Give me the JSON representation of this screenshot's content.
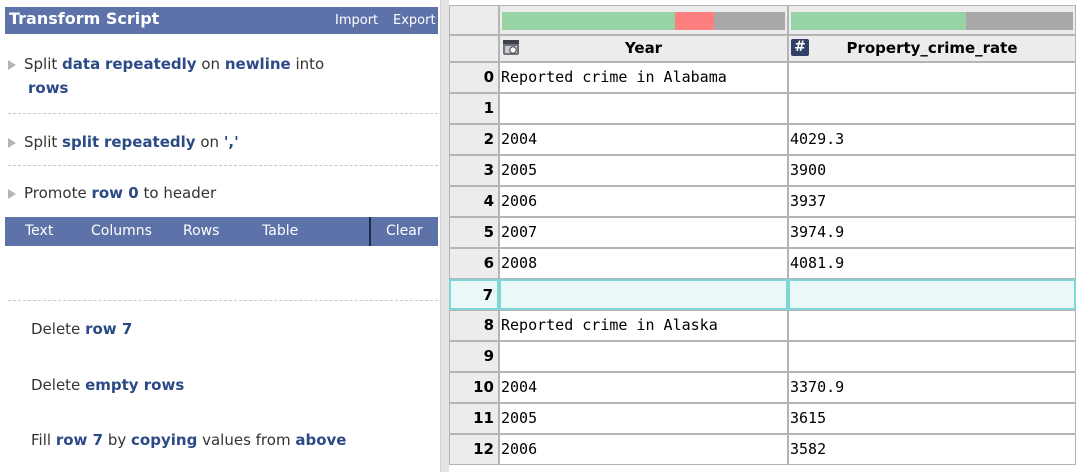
{
  "script_panel": {
    "title": "Transform Script",
    "import_label": "Import",
    "export_label": "Export"
  },
  "steps": [
    {
      "prefix": "Split",
      "p1": "data",
      "p2": "repeatedly",
      "mid": "on",
      "p3": "newline",
      "mid2": "into",
      "p4": "rows"
    },
    {
      "prefix": "Split",
      "p1": "split",
      "p2": "repeatedly",
      "mid": "on",
      "p3": "','"
    },
    {
      "prefix": "Promote",
      "p1": "row 0",
      "mid": "to header"
    }
  ],
  "tabs": {
    "text": "Text",
    "columns": "Columns",
    "rows": "Rows",
    "table": "Table",
    "clear": "Clear"
  },
  "suggestions": [
    {
      "a": "Delete",
      "b": "row 7"
    },
    {
      "a": "Delete",
      "b": "empty rows"
    },
    {
      "a": "Fill",
      "b": "row 7",
      "c": "by",
      "d": "copying",
      "e": "values from",
      "f": "above"
    }
  ],
  "table": {
    "columns": [
      {
        "name": "Year",
        "type_icon": "date-type-icon",
        "quality": {
          "valid": 0.61,
          "invalid": 0.14,
          "missing": 0.25
        }
      },
      {
        "name": "Property_crime_rate",
        "type_icon": "number-type-icon",
        "quality": {
          "valid": 0.62,
          "invalid": 0.0,
          "missing": 0.38
        }
      }
    ],
    "rows": [
      {
        "idx": "0",
        "c1": "Reported crime in Alabama",
        "c2": ""
      },
      {
        "idx": "1",
        "c1": "",
        "c2": ""
      },
      {
        "idx": "2",
        "c1": "2004",
        "c2": "4029.3"
      },
      {
        "idx": "3",
        "c1": "2005",
        "c2": "3900"
      },
      {
        "idx": "4",
        "c1": "2006",
        "c2": "3937"
      },
      {
        "idx": "5",
        "c1": "2007",
        "c2": "3974.9"
      },
      {
        "idx": "6",
        "c1": "2008",
        "c2": "4081.9"
      },
      {
        "idx": "7",
        "c1": "",
        "c2": ""
      },
      {
        "idx": "8",
        "c1": "Reported crime in Alaska",
        "c2": ""
      },
      {
        "idx": "9",
        "c1": "",
        "c2": ""
      },
      {
        "idx": "10",
        "c1": "2004",
        "c2": "3370.9"
      },
      {
        "idx": "11",
        "c1": "2005",
        "c2": "3615"
      },
      {
        "idx": "12",
        "c1": "2006",
        "c2": "3582"
      }
    ],
    "selected_row": "7"
  },
  "colors": {
    "panel_blue": "#5d72a8",
    "link_blue": "#2b4a86",
    "valid": "#98d3a5",
    "invalid": "#fd7f7f",
    "missing": "#a8a8a8",
    "selection": "#7fd6d6"
  }
}
